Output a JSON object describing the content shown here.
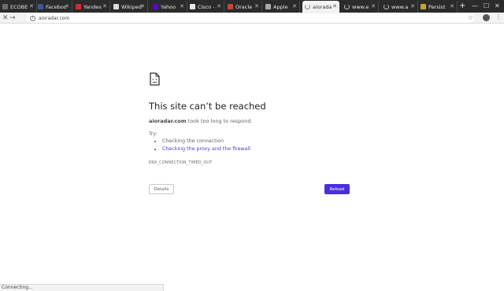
{
  "tabs": [
    {
      "title": "ECOBE",
      "icon": "ecobee-favicon",
      "color": "#6b6b6b"
    },
    {
      "title": "Faceboo",
      "icon": "facebook-favicon",
      "color": "#3b5998"
    },
    {
      "title": "Yandex",
      "icon": "yandex-favicon",
      "color": "#d02e2e"
    },
    {
      "title": "Wikiped",
      "icon": "wikipedia-favicon",
      "color": "#dddddd"
    },
    {
      "title": "Yahoo",
      "icon": "yahoo-favicon",
      "color": "#6001d2"
    },
    {
      "title": "Cisco -",
      "icon": "cisco-favicon",
      "color": "#e8e8e8"
    },
    {
      "title": "Oracle",
      "icon": "oracle-favicon",
      "color": "#c74634"
    },
    {
      "title": "Apple",
      "icon": "apple-favicon",
      "color": "#aaaaaa"
    },
    {
      "title": "aiorada",
      "icon": "loading-spinner",
      "color": "#888888"
    },
    {
      "title": "www.e",
      "icon": "loading-spinner",
      "color": "#bbbbbb"
    },
    {
      "title": "www.a",
      "icon": "loading-spinner",
      "color": "#bbbbbb"
    },
    {
      "title": "Persist",
      "icon": "persist-favicon",
      "color": "#c9a227"
    }
  ],
  "toolbar": {
    "url": "aioradar.com",
    "back": "←",
    "forward": "→",
    "stop": "✕"
  },
  "error": {
    "title": "This site can’t be reached",
    "host": "aioradar.com",
    "description_rest": "took too long to respond.",
    "try_label": "Try:",
    "suggestions": [
      {
        "text": "Checking the connection",
        "is_link": false
      },
      {
        "text": "Checking the proxy and the firewall",
        "is_link": true
      }
    ],
    "code": "ERR_CONNECTION_TIMED_OUT",
    "details_label": "Details",
    "reload_label": "Reload"
  },
  "status": "Connecting..."
}
